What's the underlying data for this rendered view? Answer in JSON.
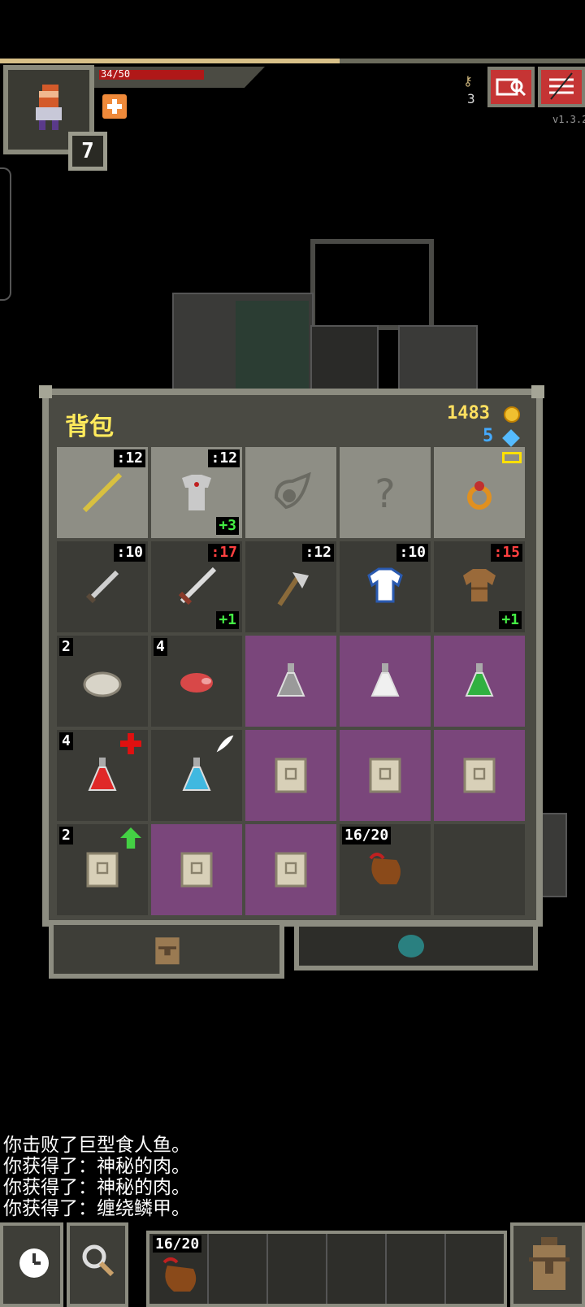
{
  "status": {
    "hp_text": "34/50",
    "hp_fraction": 0.68,
    "xp_fraction": 0.58,
    "level": "7",
    "keys_count": "3",
    "version": "v1.3.2",
    "colors": {
      "hp": "#b01818",
      "xp": "#d8c088",
      "buttons": "#c53434"
    }
  },
  "backpack": {
    "title": "背包",
    "gold": "1483",
    "energy": "5",
    "rows": [
      [
        {
          "name": "staff",
          "qty": ":12",
          "qty_red": false,
          "type": "equip",
          "icon": "staff-icon"
        },
        {
          "name": "armor",
          "qty": ":12",
          "qty_red": false,
          "upgrade": "+3",
          "type": "equip",
          "icon": "chainmail-icon"
        },
        {
          "name": "empty-artifact",
          "type": "equip",
          "icon": "artifact-slot-icon"
        },
        {
          "name": "empty-misc",
          "type": "equip",
          "icon": "unknown-slot-icon"
        },
        {
          "name": "ring",
          "type": "equip",
          "icon": "ring-icon"
        }
      ],
      [
        {
          "name": "shortsword",
          "qty": ":10",
          "qty_red": false,
          "type": "normal",
          "icon": "dagger-icon"
        },
        {
          "name": "sword",
          "qty": ":17",
          "qty_red": true,
          "upgrade": "+1",
          "type": "normal",
          "icon": "sword-icon"
        },
        {
          "name": "axe",
          "qty": ":12",
          "qty_red": false,
          "type": "normal",
          "icon": "axe-icon"
        },
        {
          "name": "cloth-armor",
          "qty": ":10",
          "qty_red": false,
          "type": "normal",
          "icon": "shirt-icon"
        },
        {
          "name": "leather-armor",
          "qty": ":15",
          "qty_red": true,
          "upgrade": "+1",
          "type": "normal",
          "icon": "leather-armor-icon"
        }
      ],
      [
        {
          "name": "pasty",
          "count": "2",
          "type": "normal",
          "icon": "pasty-icon"
        },
        {
          "name": "mystery-meat",
          "count": "4",
          "type": "normal",
          "icon": "meat-icon"
        },
        {
          "name": "potion-grey",
          "type": "unknown",
          "icon": "grey-potion-icon"
        },
        {
          "name": "potion-white",
          "type": "unknown",
          "icon": "white-potion-icon"
        },
        {
          "name": "potion-green",
          "type": "unknown",
          "icon": "green-potion-icon"
        }
      ],
      [
        {
          "name": "potion-healing",
          "count": "4",
          "type": "normal",
          "icon": "red-potion-icon",
          "badge": "healing-cross-icon"
        },
        {
          "name": "potion-levitation",
          "type": "normal",
          "icon": "blue-potion-icon",
          "badge": "feather-icon"
        },
        {
          "name": "scroll-1",
          "type": "unknown",
          "icon": "scroll-icon"
        },
        {
          "name": "scroll-2",
          "type": "unknown",
          "icon": "scroll-icon"
        },
        {
          "name": "scroll-3",
          "type": "unknown",
          "icon": "scroll-icon"
        }
      ],
      [
        {
          "name": "scroll-upgrade",
          "count": "2",
          "type": "normal",
          "icon": "scroll-icon",
          "badge": "upgrade-arrow-icon"
        },
        {
          "name": "scroll-4",
          "type": "unknown",
          "icon": "scroll-icon"
        },
        {
          "name": "scroll-5",
          "type": "unknown",
          "icon": "scroll-icon"
        },
        {
          "name": "waterskin",
          "count": "16/20",
          "type": "normal",
          "icon": "waterskin-icon"
        },
        {
          "name": "empty",
          "type": "normal",
          "icon": ""
        }
      ]
    ]
  },
  "log": [
    "你击败了巨型食人鱼。",
    "你获得了：神秘的肉。",
    "你获得了：神秘的肉。",
    "你获得了：缠绕鳞甲。"
  ],
  "toolbar": {
    "quickslot_1_qty": "16/20",
    "wait_icon": "clock-icon",
    "search_icon": "magnifier-icon",
    "inventory_icon": "backpack-icon"
  }
}
